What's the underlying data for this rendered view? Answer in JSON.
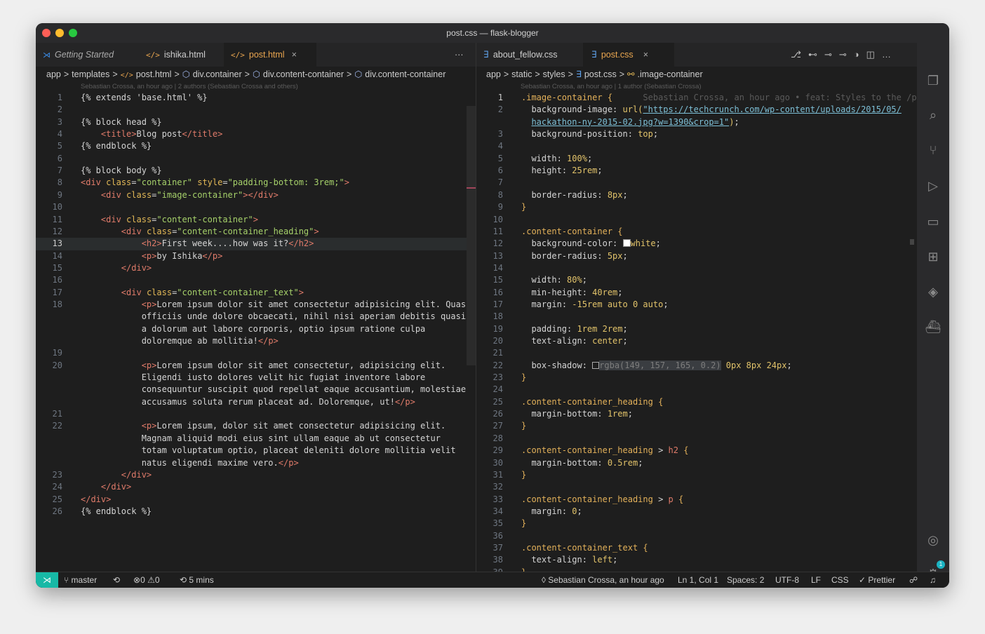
{
  "window": {
    "title": "post.css — flask-blogger"
  },
  "left_editor": {
    "tabs": [
      {
        "icon": "vscode-icon",
        "label": "Getting Started"
      },
      {
        "icon": "html-icon",
        "label": "ishika.html"
      },
      {
        "icon": "html-icon",
        "label": "post.html",
        "active": true
      }
    ],
    "more_label": "···",
    "breadcrumb": [
      "app",
      ">",
      "templates",
      ">",
      "post.html",
      ">",
      "div.container",
      ">",
      "div.content-container",
      ">",
      "div.content-container"
    ],
    "blame": "Sebastian Crossa, an hour ago | 2 authors (Sebastian Crossa and others)"
  },
  "right_editor": {
    "tabs": [
      {
        "icon": "css-icon",
        "label": "about_fellow.css"
      },
      {
        "icon": "css-icon",
        "label": "post.css",
        "active": true
      }
    ],
    "breadcrumb": [
      "app",
      ">",
      "static",
      ">",
      "styles",
      ">",
      "post.css",
      ">",
      ".image-container"
    ],
    "blame": "Sebastian Crossa, an hour ago | 1 author (Sebastian Crossa)"
  },
  "status": {
    "branch": "master",
    "errors": "0",
    "warnings": "0",
    "timer": "5 mins",
    "blame": "Sebastian Crossa, an hour ago",
    "position": "Ln 1, Col 1",
    "spaces": "Spaces: 2",
    "encoding": "UTF-8",
    "eol": "LF",
    "language": "CSS",
    "formatter": "Prettier"
  },
  "activity_badge": "1",
  "colors": {
    "accent": "#17b9a6",
    "tab_active": "#e8a54f"
  }
}
